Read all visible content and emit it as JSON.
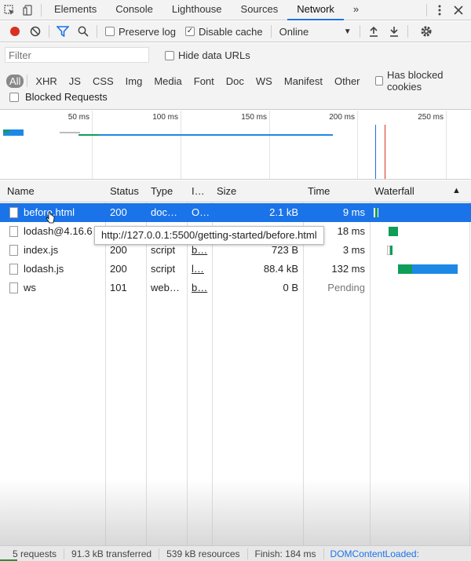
{
  "tabs": [
    {
      "label": "Elements"
    },
    {
      "label": "Console"
    },
    {
      "label": "Lighthouse"
    },
    {
      "label": "Sources"
    },
    {
      "label": "Network"
    }
  ],
  "tabs_more": "»",
  "toolbar": {
    "preserve_log": "Preserve log",
    "disable_cache": "Disable cache",
    "throttle_value": "Online"
  },
  "filter": {
    "placeholder": "Filter",
    "hide_data_urls": "Hide data URLs",
    "types": [
      "All",
      "XHR",
      "JS",
      "CSS",
      "Img",
      "Media",
      "Font",
      "Doc",
      "WS",
      "Manifest",
      "Other"
    ],
    "has_blocked_cookies": "Has blocked cookies",
    "blocked_requests": "Blocked Requests"
  },
  "overview": {
    "ticks": [
      "50 ms",
      "100 ms",
      "150 ms",
      "200 ms",
      "250 ms"
    ]
  },
  "columns": {
    "name": "Name",
    "status": "Status",
    "type": "Type",
    "initiator": "I…",
    "size": "Size",
    "time": "Time",
    "waterfall": "Waterfall"
  },
  "rows": [
    {
      "name": "before.html",
      "status": "200",
      "type": "doc…",
      "initiator": "O…",
      "size": "2.1 kB",
      "time": "9 ms"
    },
    {
      "name": "lodash@4.16.6",
      "status": "",
      "type": "",
      "initiator": "",
      "size": "",
      "time": "18 ms"
    },
    {
      "name": "index.js",
      "status": "200",
      "type": "script",
      "initiator": "b…",
      "size": "723 B",
      "time": "3 ms"
    },
    {
      "name": "lodash.js",
      "status": "200",
      "type": "script",
      "initiator": "l…",
      "size": "88.4 kB",
      "time": "132 ms"
    },
    {
      "name": "ws",
      "status": "101",
      "type": "web…",
      "initiator": "b…",
      "size": "0 B",
      "time": "Pending"
    }
  ],
  "tooltip": "http://127.0.0.1:5500/getting-started/before.html",
  "statusbar": {
    "requests": "5 requests",
    "transferred": "91.3 kB transferred",
    "resources": "539 kB resources",
    "finish": "Finish: 184 ms",
    "dcl": "DOMContentLoaded:"
  },
  "colors": {
    "accent": "#1a73e8",
    "record": "#d93025",
    "waiting": "#0f9d58",
    "download": "#1e88e5"
  }
}
